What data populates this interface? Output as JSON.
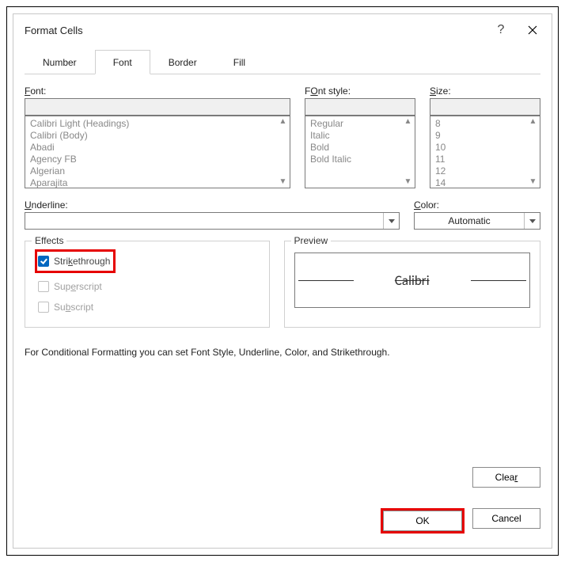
{
  "title": "Format Cells",
  "tabs": [
    {
      "label": "Number",
      "active": false
    },
    {
      "label": "Font",
      "active": true
    },
    {
      "label": "Border",
      "active": false
    },
    {
      "label": "Fill",
      "active": false
    }
  ],
  "labels": {
    "font": "Font:",
    "font_acc": "F",
    "fontStyle": "Font style:",
    "fontStyle_acc": "O",
    "size": "Size:",
    "size_acc": "S",
    "underline": "Underline:",
    "underline_acc": "U",
    "color": "Color:",
    "color_acc": "C",
    "effects": "Effects",
    "preview": "Preview"
  },
  "fontInput": "",
  "fontList": [
    "Calibri Light (Headings)",
    "Calibri (Body)",
    "Abadi",
    "Agency FB",
    "Algerian",
    "Aparajita"
  ],
  "styleInput": "",
  "styleList": [
    "Regular",
    "Italic",
    "Bold",
    "Bold Italic"
  ],
  "sizeInput": "",
  "sizeList": [
    "8",
    "9",
    "10",
    "11",
    "12",
    "14"
  ],
  "underlineValue": "",
  "colorValue": "Automatic",
  "effects": {
    "strikethrough": {
      "label": "Strikethrough",
      "pre": "Stri",
      "acc": "k",
      "post": "ethrough",
      "checked": true
    },
    "superscript": {
      "label": "Superscript",
      "pre": "Sup",
      "acc": "e",
      "post": "rscript",
      "checked": false,
      "disabled": true
    },
    "subscript": {
      "label": "Subscript",
      "pre": "Su",
      "acc": "b",
      "post": "script",
      "checked": false,
      "disabled": true
    }
  },
  "previewText": "Calibri",
  "info": "For Conditional Formatting you can set Font Style, Underline, Color, and Strikethrough.",
  "buttons": {
    "clear": "Clear",
    "clear_pre": "Clea",
    "clear_acc": "r",
    "clear_post": "",
    "ok": "OK",
    "cancel": "Cancel"
  }
}
